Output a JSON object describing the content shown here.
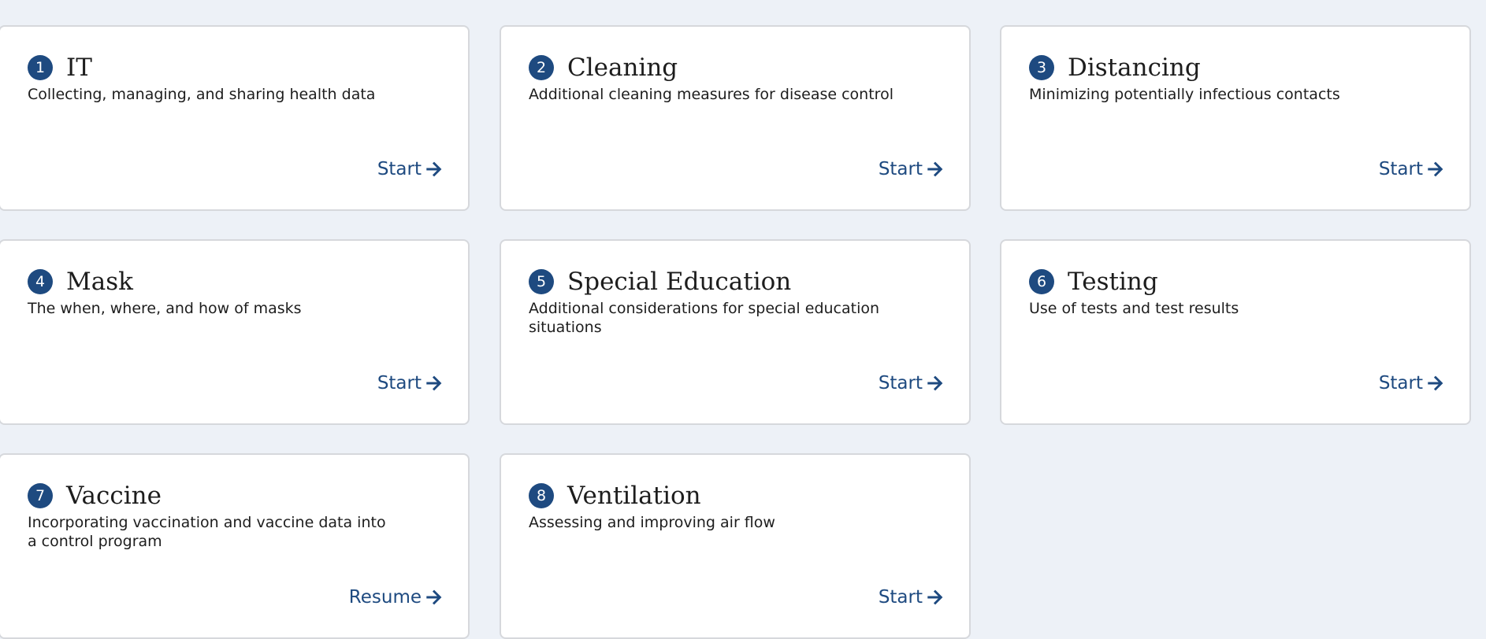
{
  "colors": {
    "background": "#edf1f7",
    "card": "#ffffff",
    "card_border": "#d6d8dc",
    "accent": "#1e4a80",
    "text": "#1d1d1d"
  },
  "icons": {
    "action_arrow": "arrow-right-icon"
  },
  "cards": [
    {
      "number": "1",
      "title": "IT",
      "description": "Collecting, managing, and sharing health data",
      "action": "Start"
    },
    {
      "number": "2",
      "title": "Cleaning",
      "description": "Additional cleaning measures for disease control",
      "action": "Start"
    },
    {
      "number": "3",
      "title": "Distancing",
      "description": "Minimizing potentially infectious contacts",
      "action": "Start"
    },
    {
      "number": "4",
      "title": "Mask",
      "description": "The when, where, and how of masks",
      "action": "Start"
    },
    {
      "number": "5",
      "title": "Special Education",
      "description": "Additional considerations for special education situations",
      "action": "Start"
    },
    {
      "number": "6",
      "title": "Testing",
      "description": "Use of tests and test results",
      "action": "Start"
    },
    {
      "number": "7",
      "title": "Vaccine",
      "description": "Incorporating vaccination and vaccine data into a control program",
      "action": "Resume"
    },
    {
      "number": "8",
      "title": "Ventilation",
      "description": "Assessing and improving air flow",
      "action": "Start"
    }
  ]
}
